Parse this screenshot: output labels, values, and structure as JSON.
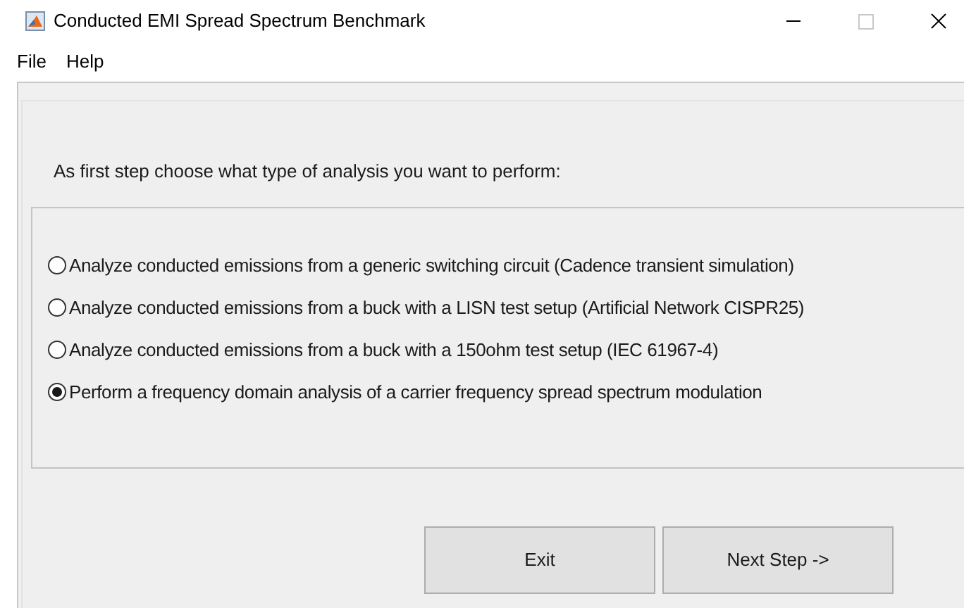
{
  "window": {
    "title": "Conducted EMI Spread Spectrum Benchmark"
  },
  "menu": [
    "File",
    "Help"
  ],
  "prompt": "As first step choose what type of analysis you want to perform:",
  "options": [
    {
      "label": "Analyze conducted emissions from a generic switching circuit (Cadence transient simulation)",
      "selected": false
    },
    {
      "label": "Analyze conducted emissions from a buck with a LISN test setup (Artificial Network CISPR25)",
      "selected": false
    },
    {
      "label": "Analyze conducted emissions from a buck with a 150ohm test setup (IEC 61967-4)",
      "selected": false
    },
    {
      "label": "Perform a frequency domain analysis of a carrier frequency spread spectrum modulation",
      "selected": true
    }
  ],
  "buttons": [
    "Exit",
    "Next Step ->"
  ]
}
